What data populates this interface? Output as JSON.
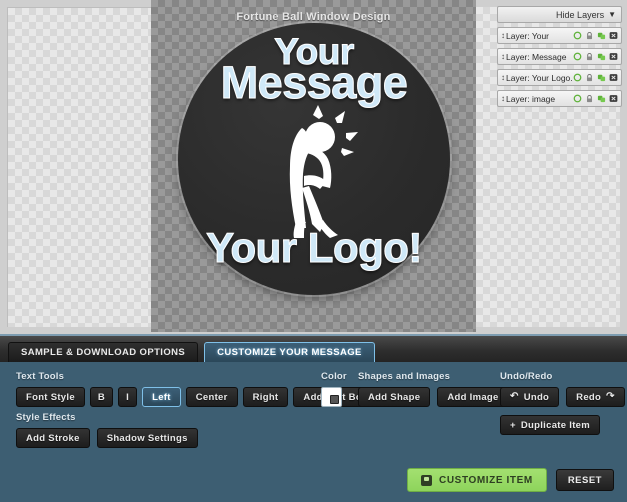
{
  "design": {
    "title": "Fortune Ball Window Design",
    "text_lines": {
      "line1": "Your",
      "line2": "Message",
      "line3": "Your Logo!"
    },
    "figure_icon": "celebrating-person-icon",
    "ball_color": "#2b2b2b",
    "text_color": "#cfe8f7"
  },
  "layers": {
    "header_label": "Hide Layers",
    "header_caret": "☰",
    "items": [
      {
        "grip": "↕",
        "label": "Layer: Your"
      },
      {
        "grip": "↕",
        "label": "Layer: Message"
      },
      {
        "grip": "↕",
        "label": "Layer: Your Logo."
      },
      {
        "grip": "↕",
        "label": "Layer: image"
      }
    ],
    "row_icons": [
      "visibility-icon",
      "lock-icon",
      "duplicate-icon",
      "delete-icon"
    ]
  },
  "tabs": [
    {
      "label": "SAMPLE & DOWNLOAD OPTIONS",
      "active": false
    },
    {
      "label": "CUSTOMIZE YOUR MESSAGE",
      "active": true
    }
  ],
  "text_tools": {
    "group_label": "Text Tools",
    "buttons": [
      {
        "label": "Font Style",
        "selected": false
      },
      {
        "label": "B",
        "selected": false
      },
      {
        "label": "I",
        "selected": false
      },
      {
        "label": "Left",
        "selected": true
      },
      {
        "label": "Center",
        "selected": false
      },
      {
        "label": "Right",
        "selected": false
      },
      {
        "label": "Add Text Box",
        "selected": false
      }
    ]
  },
  "style_effects": {
    "group_label": "Style Effects",
    "buttons": [
      {
        "label": "Add Stroke"
      },
      {
        "label": "Shadow Settings"
      }
    ]
  },
  "color": {
    "group_label": "Color",
    "value": "#ffffff"
  },
  "shapes_images": {
    "group_label": "Shapes and Images",
    "buttons": [
      {
        "label": "Add Shape"
      },
      {
        "label": "Add Image"
      }
    ]
  },
  "undo_redo": {
    "group_label": "Undo/Redo",
    "undo_label": "Undo",
    "undo_icon": "↶",
    "redo_label": "Redo",
    "redo_icon": "↷",
    "duplicate_label": "Duplicate Item",
    "duplicate_icon": "+"
  },
  "actions": {
    "customize_label": "CUSTOMIZE ITEM",
    "reset_label": "RESET"
  }
}
